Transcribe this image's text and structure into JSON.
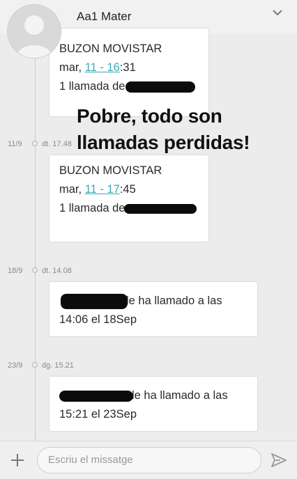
{
  "header": {
    "contact_name": "Aa1 Mater"
  },
  "overlay_text": {
    "line1": "Pobre, todo son",
    "line2": "llamadas perdidas!"
  },
  "messages": [
    {
      "line1": "BUZON MOVISTAR",
      "line2_prefix": "mar, ",
      "line2_link": "11 - 16",
      "line2_suffix": ":31",
      "line3": "1 llamada de"
    },
    {
      "date": "11/9",
      "time": "dt. 17.48",
      "line1": "BUZON MOVISTAR",
      "line2_prefix": "mar, ",
      "line2_link": "11 - 17",
      "line2_suffix": ":45",
      "line3": "1 llamada de"
    },
    {
      "date": "18/9",
      "time": "dt. 14.08",
      "line1_suffix": "le ha llamado a las",
      "line2": "14:06 el 18Sep"
    },
    {
      "date": "23/9",
      "time": "dg. 15.21",
      "line1_suffix": "le ha llamado a las",
      "line2": "15:21 el 23Sep"
    }
  ],
  "compose": {
    "placeholder": "Escriu el missatge"
  },
  "colors": {
    "link": "#3aa9b3",
    "background": "#ececec",
    "bubble": "#ffffff"
  }
}
